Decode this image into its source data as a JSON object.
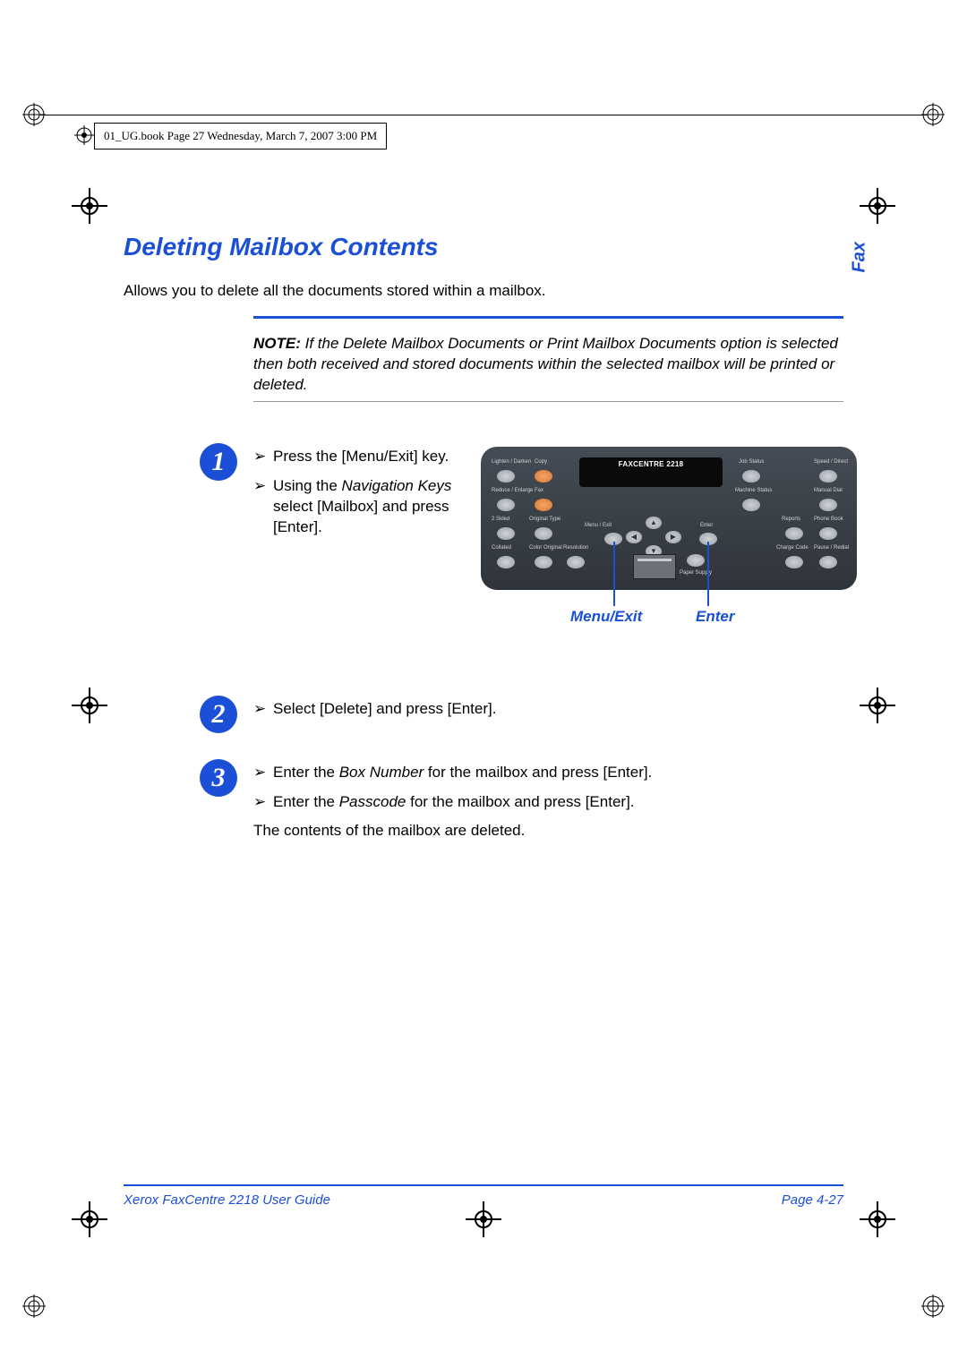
{
  "docstamp": "01_UG.book  Page 27  Wednesday, March 7, 2007  3:00 PM",
  "section_title": "Deleting Mailbox Contents",
  "tab_label": "Fax",
  "intro": "Allows you to delete all the documents stored within a mailbox.",
  "note_label": "NOTE:",
  "note_text": " If the Delete Mailbox Documents or Print Mailbox Documents option is selected then both received and stored documents within the selected mailbox will be printed or deleted.",
  "steps": {
    "s1": {
      "num": "1",
      "items": [
        {
          "pre": "Press the [Menu/Exit] key."
        },
        {
          "pre": "Using the ",
          "em": "Navigation Keys",
          "post": " select [Mailbox] and press [Enter]."
        }
      ]
    },
    "s2": {
      "num": "2",
      "items": [
        {
          "pre": "Select [Delete] and press [Enter]."
        }
      ]
    },
    "s3": {
      "num": "3",
      "items": [
        {
          "pre": "Enter the ",
          "em": "Box Number",
          "post": " for the mailbox and press [Enter]."
        },
        {
          "pre": "Enter the ",
          "em": "Passcode",
          "post": " for the mailbox and press [Enter]."
        }
      ],
      "after": "The contents of the mailbox are deleted."
    }
  },
  "panel": {
    "display_title": "FAXCENTRE 2218",
    "callout_menuexit": "Menu/Exit",
    "callout_enter": "Enter",
    "labels": {
      "lighten_darken": "Lighten / Darken",
      "copy": "Copy",
      "job_status": "Job Status",
      "speed_direct": "Speed / Direct",
      "reduce_enlarge": "Reduce / Enlarge",
      "fax": "Fax",
      "machine_status": "Machine Status",
      "manual_dial": "Manual Dial",
      "two_sided": "2 Sided",
      "original_type": "Original Type",
      "menu_exit": "Menu / Exit",
      "enter": "Enter",
      "reports": "Reports",
      "phone_book": "Phone Book",
      "collated": "Collated",
      "color_original": "Color Original",
      "resolution": "Resolution",
      "paper_supply": "Paper Supply",
      "charge_code": "Charge Code",
      "pause_redial": "Pause / Redial"
    }
  },
  "footer": {
    "left": "Xerox FaxCentre 2218 User Guide",
    "right": "Page 4-27"
  }
}
